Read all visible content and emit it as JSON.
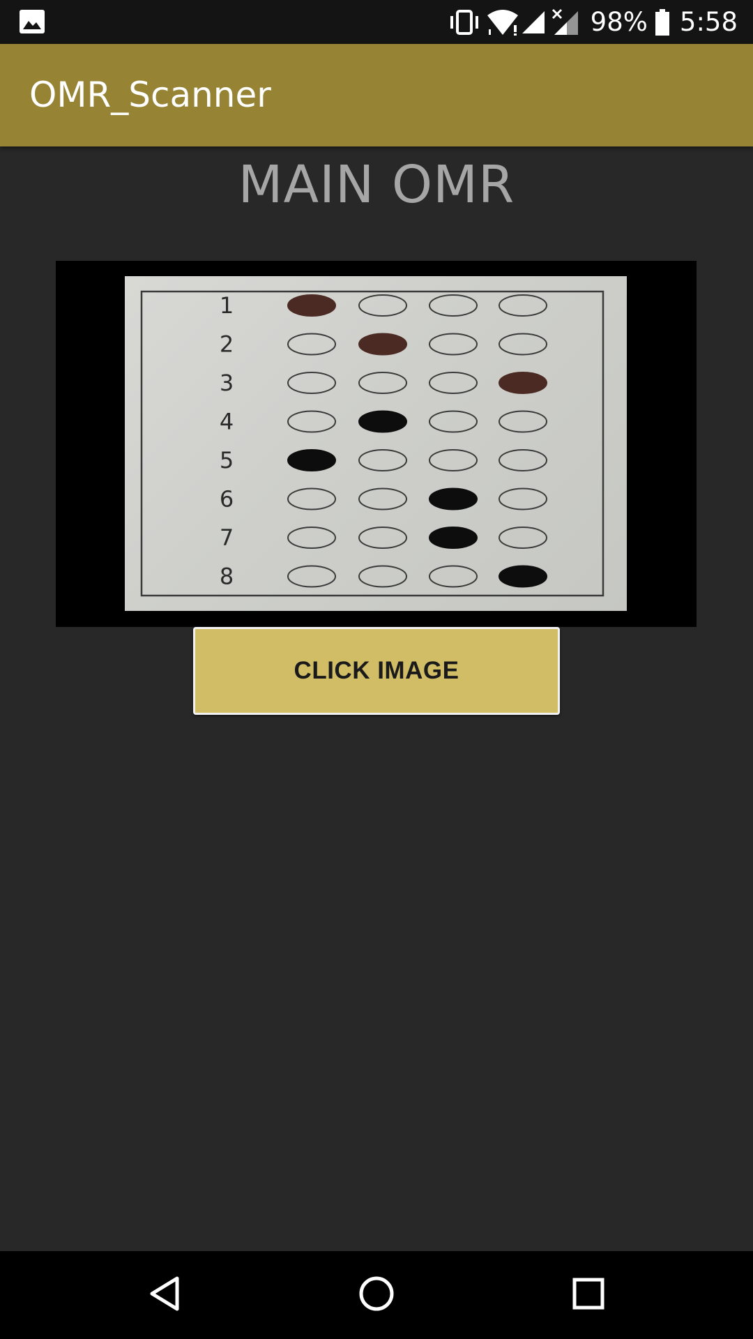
{
  "status_bar": {
    "left_icon": "image-icon",
    "vibrate_icon": "vibrate-icon",
    "wifi_icon": "wifi-icon",
    "signal_icon": "signal-icon",
    "signal_no_data_icon": "signal-off-icon",
    "battery_percent": "98%",
    "battery_icon": "battery-icon",
    "time": "5:58"
  },
  "app_bar": {
    "title": "OMR_Scanner",
    "color": "#968334"
  },
  "main": {
    "heading": "MAIN OMR",
    "image": {
      "description_icon": "omr-sheet-photo",
      "question_numbers": [
        "1",
        "2",
        "3",
        "4",
        "5",
        "6",
        "7",
        "8"
      ],
      "options_per_question": 4,
      "filled_answers": [
        1,
        2,
        4,
        2,
        1,
        3,
        3,
        4
      ]
    },
    "button_label": "CLICK IMAGE",
    "button_color": "#d1bd66"
  },
  "nav_bar": {
    "back_icon": "back-icon",
    "home_icon": "home-icon",
    "recents_icon": "recents-icon"
  }
}
